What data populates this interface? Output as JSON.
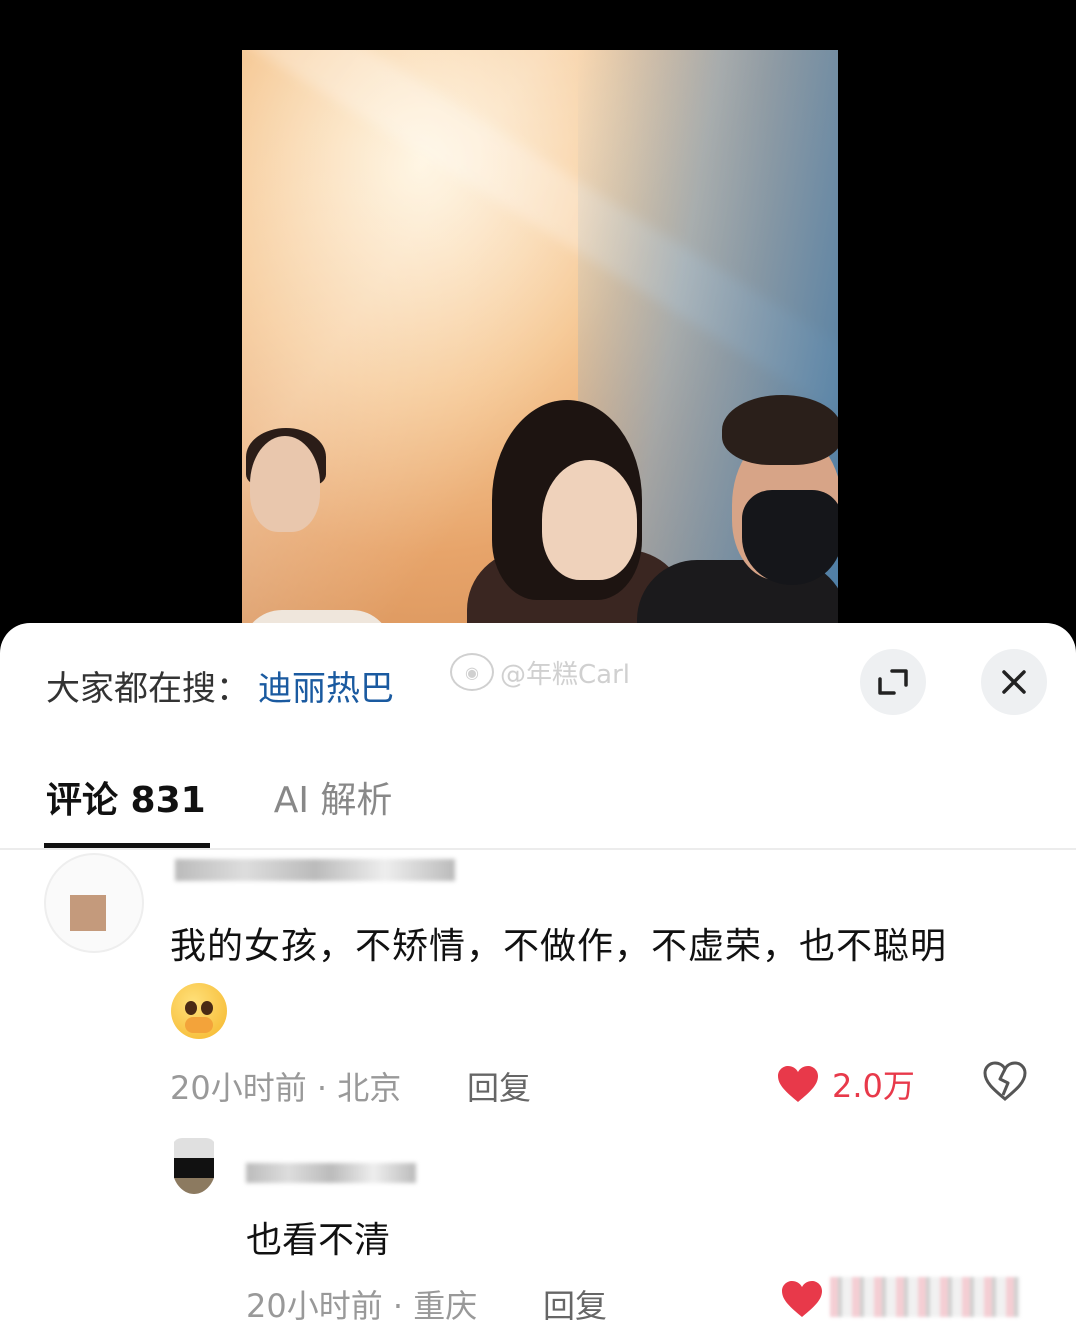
{
  "video": {
    "description_icon": "video-frame"
  },
  "search_bar": {
    "prefix": "大家都在搜：",
    "term": "迪丽热巴",
    "watermark": "@年糕Carl"
  },
  "buttons": {
    "expand_icon": "expand-icon",
    "close_icon": "close-icon"
  },
  "tabs": [
    {
      "label": "评论 831",
      "active": true
    },
    {
      "label": "AI 解析",
      "active": false
    }
  ],
  "comments": [
    {
      "text": "我的女孩，不矫情，不做作，不虚荣，也不聪明",
      "emoji": "pleading-face-emoji",
      "meta": "20小时前 · 北京",
      "reply_label": "回复",
      "likes": "2.0万"
    },
    {
      "text": "也看不清",
      "meta": "20小时前 · 重庆",
      "reply_label": "回复"
    }
  ],
  "colors": {
    "search_term": "#1a5aa0",
    "like_red": "#e8394a",
    "sheet_bg": "#ffffff",
    "video_bg": "#000000"
  }
}
